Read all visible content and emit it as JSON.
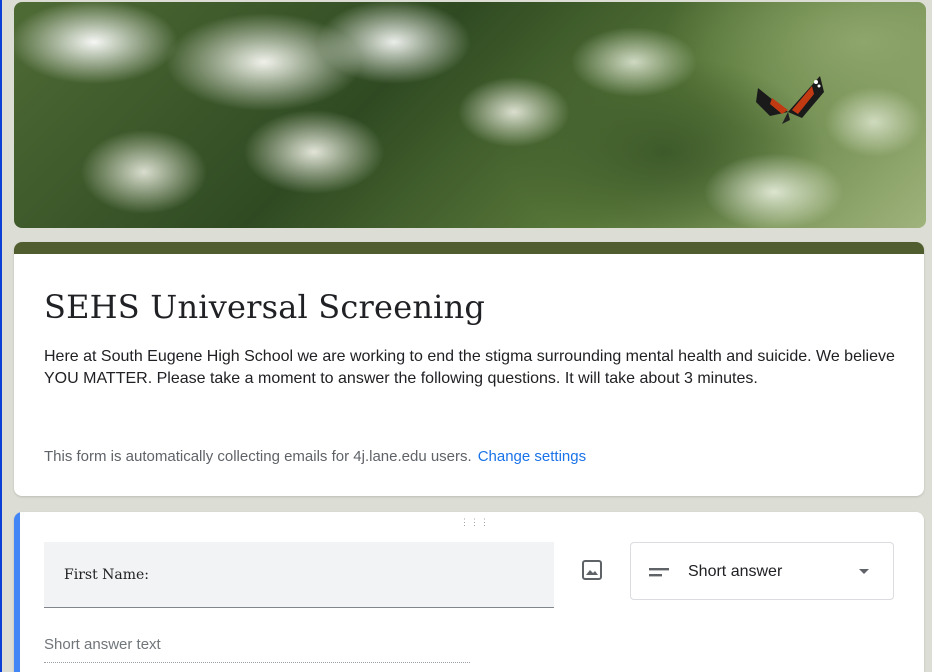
{
  "header": {
    "banner_icon": "flowers-butterfly-image"
  },
  "form": {
    "title": "SEHS Universal Screening",
    "description": "Here at South Eugene High School we are working to end the stigma surrounding mental health and suicide. We believe YOU MATTER. Please take a moment to answer the following questions. It will take about 3 minutes.",
    "collecting_notice": "This form is automatically collecting emails for 4j.lane.edu users.",
    "change_settings_label": "Change settings"
  },
  "question": {
    "drag_handle_glyph": "⋮⋮⋮",
    "title": "First Name:",
    "type_label": "Short answer",
    "answer_placeholder": "Short answer text"
  },
  "colors": {
    "accent": "#4f5d2f",
    "link": "#1a73e8",
    "active_bar": "#4285f4"
  }
}
